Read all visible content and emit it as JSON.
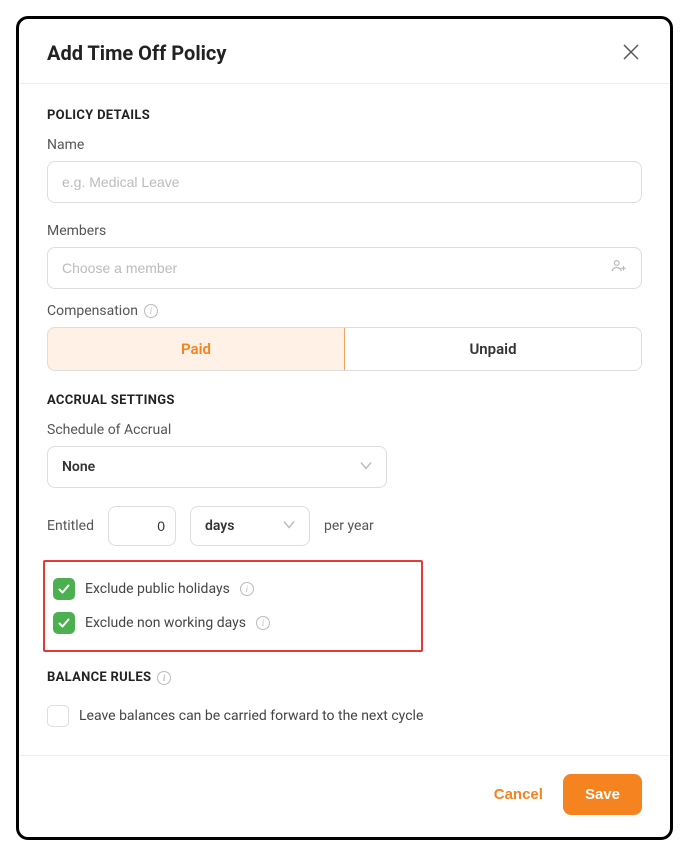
{
  "header": {
    "title": "Add Time Off Policy"
  },
  "policy_details": {
    "heading": "POLICY DETAILS",
    "name_label": "Name",
    "name_placeholder": "e.g. Medical Leave",
    "name_value": "",
    "members_label": "Members",
    "members_placeholder": "Choose a member",
    "members_value": "",
    "compensation_label": "Compensation",
    "compensation_options": {
      "paid": "Paid",
      "unpaid": "Unpaid"
    },
    "compensation_selected": "Paid"
  },
  "accrual": {
    "heading": "ACCRUAL SETTINGS",
    "schedule_label": "Schedule of Accrual",
    "schedule_value": "None",
    "entitled_label": "Entitled",
    "entitled_value": "0",
    "unit_value": "days",
    "per_label": "per year",
    "exclude_holidays": {
      "label": "Exclude public holidays",
      "checked": true
    },
    "exclude_nonworking": {
      "label": "Exclude non working days",
      "checked": true
    }
  },
  "balance_rules": {
    "heading": "BALANCE RULES",
    "carry_forward": {
      "label": "Leave balances can be carried forward to the next cycle",
      "checked": false
    }
  },
  "footer": {
    "cancel": "Cancel",
    "save": "Save"
  },
  "colors": {
    "accent": "#f5831f",
    "highlight_border": "#e53935",
    "checkbox_green": "#4caf50"
  }
}
